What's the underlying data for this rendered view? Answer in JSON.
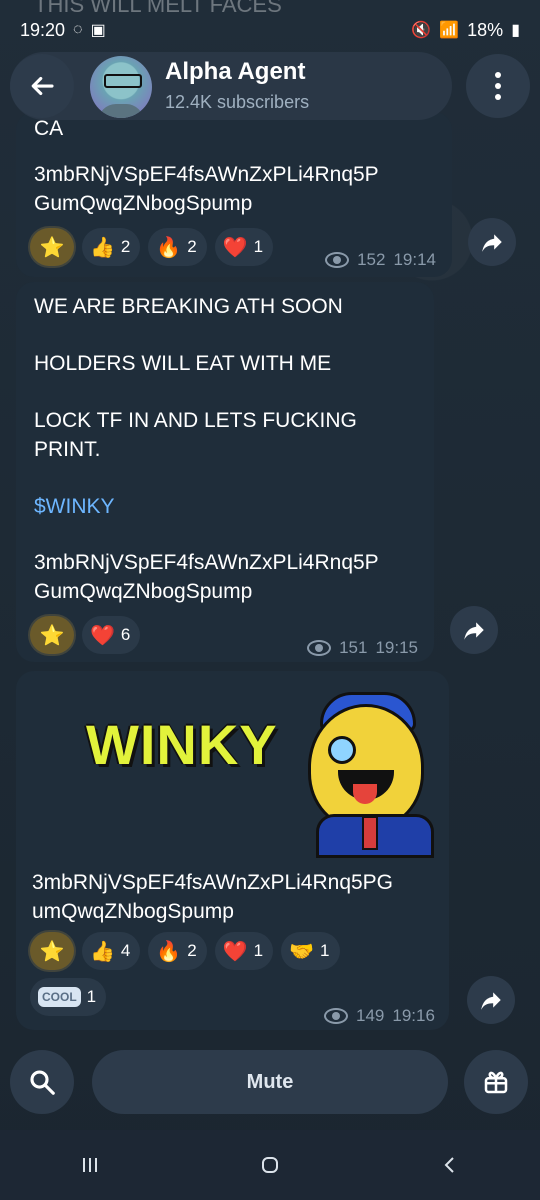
{
  "status_bar": {
    "time": "19:20",
    "battery": "18%"
  },
  "ghost_top_text": "THIS WILL MELT FACES",
  "header": {
    "title": "Alpha Agent",
    "subtitle": "12.4K subscribers"
  },
  "messages": [
    {
      "text_top": "CA",
      "address": "3mbRNjVSpEF4fsAWnZxPLi4Rnq5P\nGumQwqZNbogSpump",
      "reactions": [
        {
          "type": "star",
          "count": ""
        },
        {
          "type": "thumbs-up",
          "count": "2"
        },
        {
          "type": "fire",
          "count": "2"
        },
        {
          "type": "heart",
          "count": "1"
        }
      ],
      "views": "152",
      "time": "19:14"
    },
    {
      "line1": "WE ARE BREAKING ATH SOON",
      "line2": "HOLDERS WILL EAT WITH ME",
      "line3": "LOCK TF IN AND LETS FUCKING PRINT.",
      "ticker": "$WINKY",
      "address": "3mbRNjVSpEF4fsAWnZxPLi4Rnq5P\nGumQwqZNbogSpump",
      "reactions": [
        {
          "type": "star",
          "count": ""
        },
        {
          "type": "heart",
          "count": "6"
        }
      ],
      "views": "151",
      "time": "19:15"
    },
    {
      "banner_text": "WINKY",
      "address": "3mbRNjVSpEF4fsAWnZxPLi4Rnq5PG\numQwqZNbogSpump",
      "reactions": [
        {
          "type": "star",
          "count": ""
        },
        {
          "type": "thumbs-up",
          "count": "4"
        },
        {
          "type": "fire",
          "count": "2"
        },
        {
          "type": "heart",
          "count": "1"
        },
        {
          "type": "handshake",
          "count": "1"
        },
        {
          "type": "cool",
          "count": "1"
        }
      ],
      "cool_label": "COOL",
      "views": "149",
      "time": "19:16"
    }
  ],
  "bottom": {
    "mute_label": "Mute"
  },
  "colors": {
    "background": "#1c2833",
    "bubble": "#1f2d3a",
    "link": "#6db6ff",
    "header": "#2a3746"
  }
}
